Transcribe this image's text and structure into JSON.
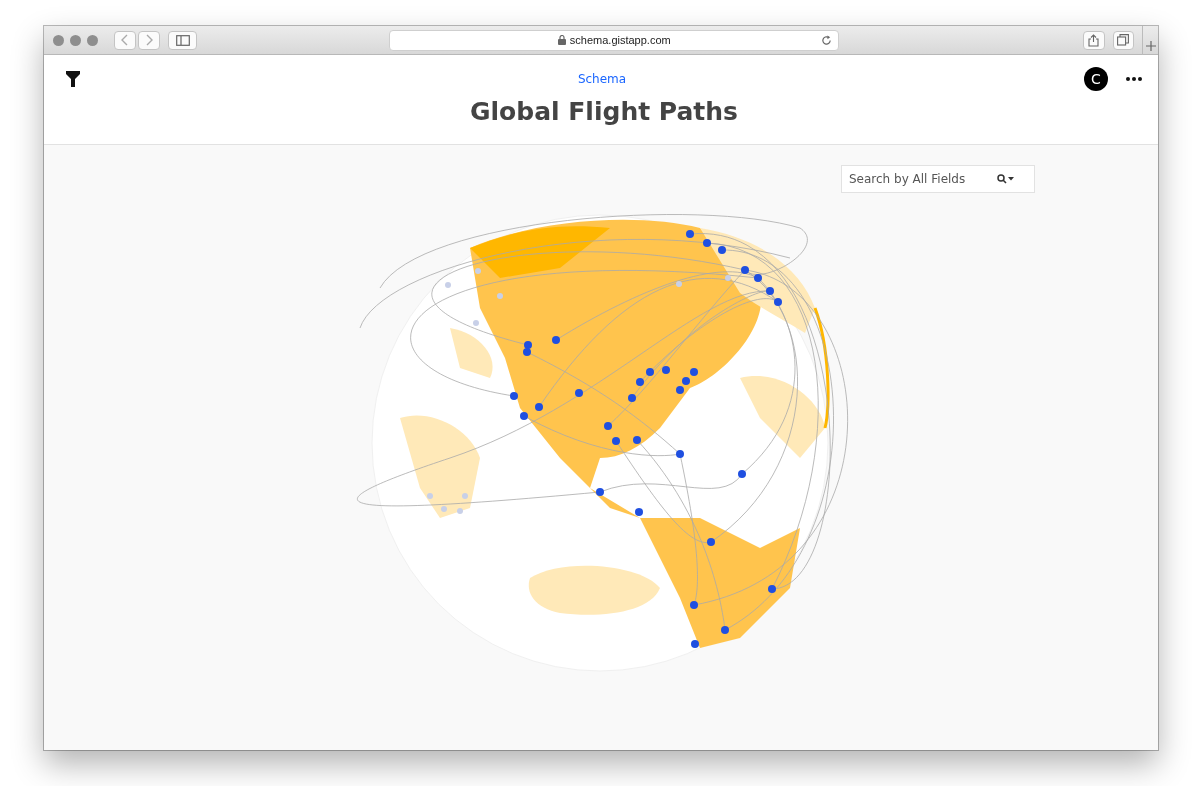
{
  "browser": {
    "url": "schema.gistapp.com"
  },
  "header": {
    "app_name": "Schema",
    "avatar_letter": "C",
    "title": "Global Flight Paths"
  },
  "search": {
    "placeholder": "Search by All Fields"
  }
}
